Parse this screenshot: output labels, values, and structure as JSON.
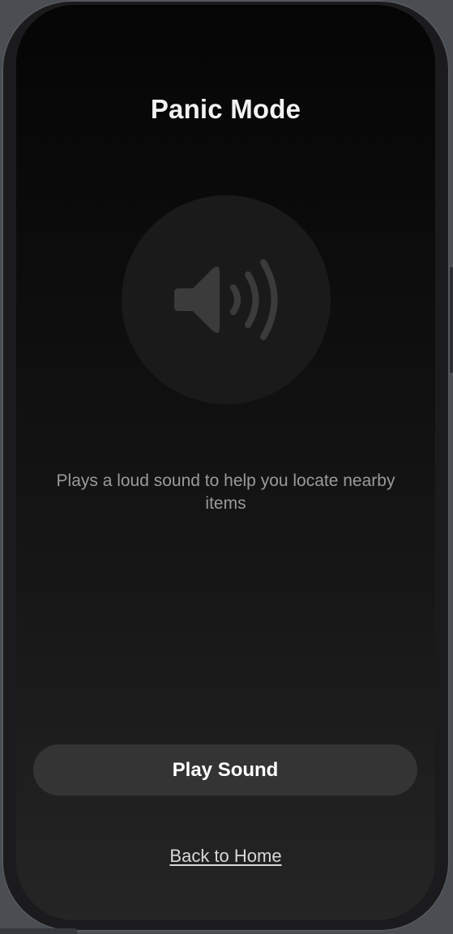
{
  "screen": {
    "title": "Panic Mode",
    "icon": "speaker-wave-icon",
    "description": "Plays a loud sound to help you locate nearby items",
    "primary_button_label": "Play Sound",
    "back_link_label": "Back to Home"
  },
  "colors": {
    "background_top": "#050505",
    "background_bottom": "#252525",
    "title": "#f2f2f2",
    "icon": "#3b3b3b",
    "icon_circle": "#1a1a1a",
    "description": "#9a9a9a",
    "button_bg": "#343434",
    "button_text": "#ffffff",
    "link_text": "#d8d8d8"
  }
}
